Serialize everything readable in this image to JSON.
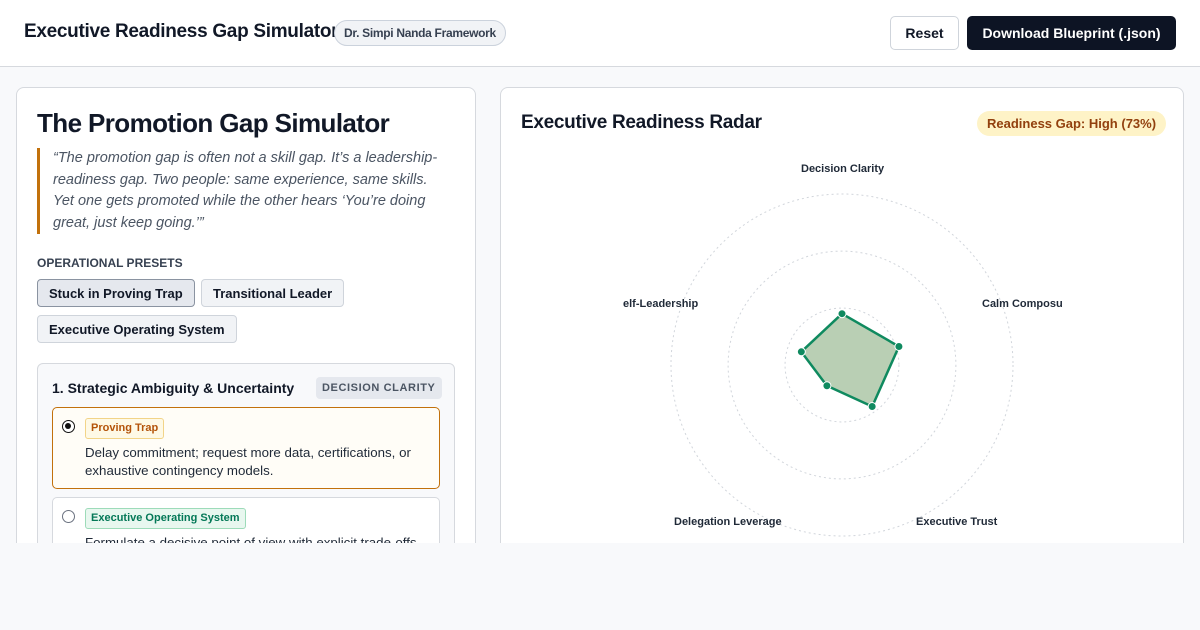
{
  "header": {
    "title": "Executive Readiness Gap Simulator",
    "framework_badge": "Dr. Simpi Nanda Framework",
    "reset_label": "Reset",
    "download_label": "Download Blueprint (.json)"
  },
  "left_panel": {
    "title": "The Promotion Gap Simulator",
    "quote": "“The promotion gap is often not a skill gap. It’s a leadership-readiness gap. Two people: same experience, same skills. Yet one gets promoted while the other hears ‘You’re doing great, just keep going.’”",
    "presets_label": "Operational Presets",
    "presets": [
      {
        "label": "Stuck in Proving Trap",
        "active": true
      },
      {
        "label": "Transitional Leader",
        "active": false
      },
      {
        "label": "Executive Operating System",
        "active": false
      }
    ],
    "scenario": {
      "title": "1. Strategic Ambiguity & Uncertainty",
      "tag": "DECISION CLARITY",
      "options": [
        {
          "badge": "Proving Trap",
          "kind": "trap",
          "text": "Delay commitment; request more data, certifications, or exhaustive contingency models.",
          "selected": true
        },
        {
          "badge": "Executive Operating System",
          "kind": "exec",
          "text": "Formulate a decisive point of view with explicit trade-offs.",
          "selected": false
        }
      ]
    }
  },
  "radar": {
    "title": "Executive Readiness Radar",
    "gap_badge": "Readiness Gap: High (73%)",
    "axes": [
      "Decision Clarity",
      "Calm Composu",
      "Executive Trust",
      "Delegation Leverage",
      "elf-Leadership"
    ],
    "values": [
      0.3,
      0.35,
      0.3,
      0.15,
      0.25
    ],
    "ring_levels": [
      0.333,
      0.666,
      1.0
    ],
    "colors": {
      "stroke": "#0f8a5f",
      "fill": "#b9cfb4",
      "grid": "#d1d5db"
    }
  }
}
